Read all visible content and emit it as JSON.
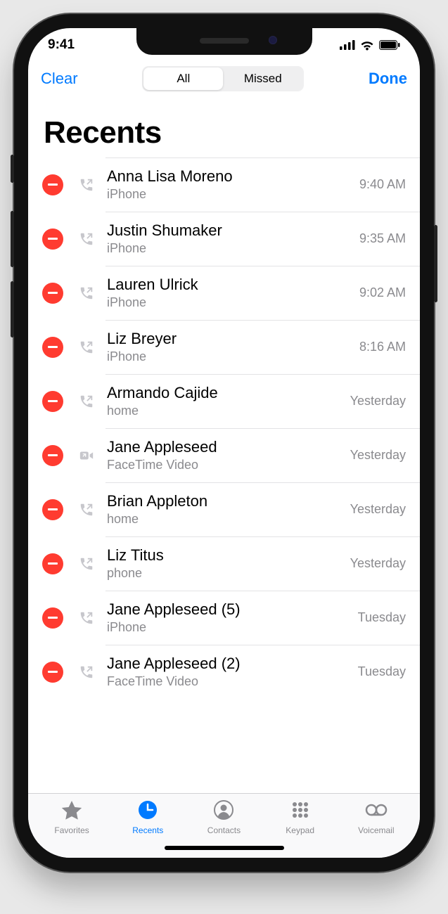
{
  "status": {
    "time": "9:41"
  },
  "nav": {
    "clear": "Clear",
    "done": "Done",
    "seg_all": "All",
    "seg_missed": "Missed"
  },
  "title": "Recents",
  "calls": [
    {
      "name": "Anna Lisa Moreno",
      "sub": "iPhone",
      "time": "9:40 AM",
      "icon": "outgoing"
    },
    {
      "name": "Justin Shumaker",
      "sub": "iPhone",
      "time": "9:35 AM",
      "icon": "outgoing"
    },
    {
      "name": "Lauren Ulrick",
      "sub": "iPhone",
      "time": "9:02 AM",
      "icon": "outgoing"
    },
    {
      "name": "Liz Breyer",
      "sub": "iPhone",
      "time": "8:16 AM",
      "icon": "outgoing"
    },
    {
      "name": "Armando Cajide",
      "sub": "home",
      "time": "Yesterday",
      "icon": "outgoing"
    },
    {
      "name": "Jane Appleseed",
      "sub": "FaceTime Video",
      "time": "Yesterday",
      "icon": "facetime"
    },
    {
      "name": "Brian Appleton",
      "sub": "home",
      "time": "Yesterday",
      "icon": "outgoing"
    },
    {
      "name": "Liz Titus",
      "sub": "phone",
      "time": "Yesterday",
      "icon": "outgoing"
    },
    {
      "name": "Jane Appleseed (5)",
      "sub": "iPhone",
      "time": "Tuesday",
      "icon": "outgoing"
    },
    {
      "name": "Jane Appleseed (2)",
      "sub": "FaceTime Video",
      "time": "Tuesday",
      "icon": "outgoing"
    }
  ],
  "tabs": {
    "favorites": "Favorites",
    "recents": "Recents",
    "contacts": "Contacts",
    "keypad": "Keypad",
    "voicemail": "Voicemail"
  }
}
